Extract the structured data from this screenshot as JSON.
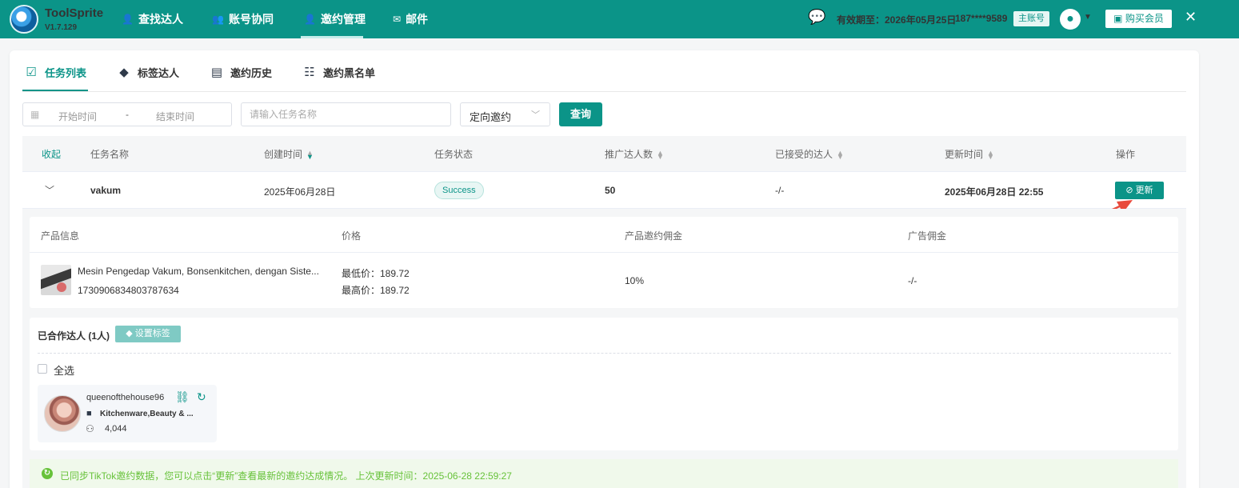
{
  "app": {
    "brand": "ToolSprite",
    "version": "V1.7.129",
    "nav": [
      {
        "label": "查找达人",
        "icon": "user-icon"
      },
      {
        "label": "账号协同",
        "icon": "users-icon"
      },
      {
        "label": "邀约管理",
        "icon": "invite-icon"
      },
      {
        "label": "邮件",
        "icon": "mail-icon"
      }
    ],
    "expiry": "有效期至：2026年05月25日",
    "phone": "187****9589",
    "account_badge": "主账号",
    "buy_label": "购买会员"
  },
  "tabs": [
    {
      "label": "任务列表",
      "icon": "task-list-icon",
      "active": true
    },
    {
      "label": "标签达人",
      "icon": "tag-icon"
    },
    {
      "label": "邀约历史",
      "icon": "history-icon"
    },
    {
      "label": "邀约黑名单",
      "icon": "blacklist-icon"
    }
  ],
  "filters": {
    "start_placeholder": "开始时间",
    "range_separator": "-",
    "end_placeholder": "结束时间",
    "task_placeholder": "请输入任务名称",
    "invite_type": "定向邀约",
    "query_label": "查询"
  },
  "table": {
    "columns": [
      "收起",
      "任务名称",
      "创建时间",
      "任务状态",
      "推广达人数",
      "已接受的达人",
      "更新时间",
      "操作"
    ],
    "rows": [
      {
        "task_name": "vakum",
        "created": "2025年06月28日",
        "status": "Success",
        "promoted_count": "50",
        "accepted": "-/-",
        "updated": "2025年06月28日 22:55",
        "action_label": "更新"
      }
    ]
  },
  "product": {
    "columns": [
      "产品信息",
      "价格",
      "产品邀约佣金",
      "广告佣金"
    ],
    "title": "Mesin Pengedap Vakum, Bonsenkitchen, dengan Siste...",
    "id": "1730906834803787634",
    "min_price": "最低价：189.72",
    "max_price": "最高价：189.72",
    "commission": "10%",
    "ad_commission": "-/-"
  },
  "cooperation": {
    "title": "已合作达人 (1人)",
    "set_tag_label": "设置标签",
    "select_all_label": "全选",
    "creators": [
      {
        "name": "queenofthehouse96",
        "category": "Kitchenware,Beauty & ...",
        "followers": "4,044"
      }
    ]
  },
  "sync": {
    "message": "已同步TikTok邀约数据，您可以点击“更新”查看最新的邀约达成情况。 上次更新时间：2025-06-28 22:59:27"
  },
  "colors": {
    "primary": "#0b9488",
    "success": "#67c23a",
    "annotation": "#e84a3c"
  }
}
